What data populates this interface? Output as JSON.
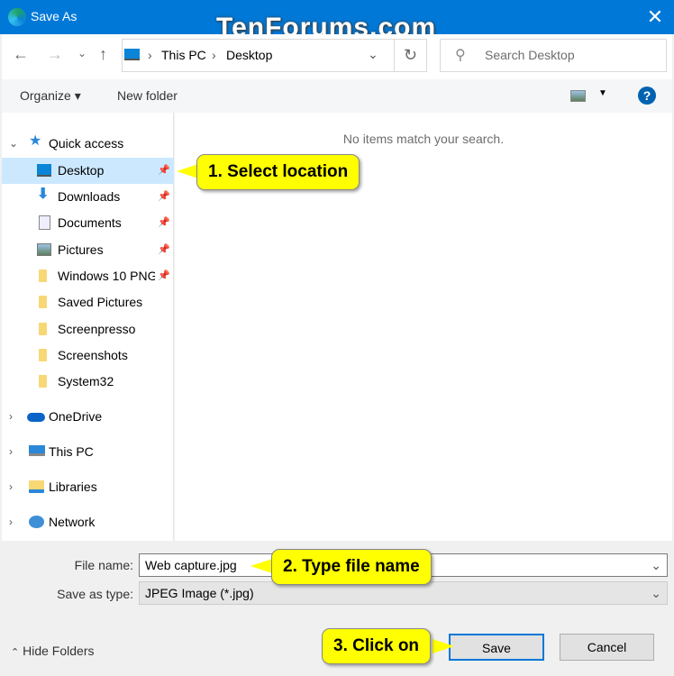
{
  "window": {
    "title": "Save As",
    "watermark": "TenForums.com"
  },
  "nav": {
    "breadcrumb": [
      "This PC",
      "Desktop"
    ],
    "search_placeholder": "Search Desktop"
  },
  "toolbar": {
    "organize": "Organize",
    "new_folder": "New folder"
  },
  "sidebar": {
    "items": [
      {
        "label": "Quick access",
        "icon": "star-icon",
        "level": 0,
        "expanded": true
      },
      {
        "label": "Desktop",
        "icon": "desktop-icon",
        "level": 1,
        "pinned": true,
        "selected": true
      },
      {
        "label": "Downloads",
        "icon": "download-icon",
        "level": 1,
        "pinned": true
      },
      {
        "label": "Documents",
        "icon": "document-icon",
        "level": 1,
        "pinned": true
      },
      {
        "label": "Pictures",
        "icon": "pictures-icon",
        "level": 1,
        "pinned": true
      },
      {
        "label": "Windows 10 PNG",
        "icon": "folder-icon",
        "level": 1,
        "pinned": true
      },
      {
        "label": "Saved Pictures",
        "icon": "folder-icon",
        "level": 1
      },
      {
        "label": "Screenpresso",
        "icon": "folder-icon",
        "level": 1
      },
      {
        "label": "Screenshots",
        "icon": "folder-icon",
        "level": 1
      },
      {
        "label": "System32",
        "icon": "folder-icon",
        "level": 1
      },
      {
        "label": "OneDrive",
        "icon": "cloud-icon",
        "level": 0
      },
      {
        "label": "This PC",
        "icon": "pc-icon",
        "level": 0
      },
      {
        "label": "Libraries",
        "icon": "library-icon",
        "level": 0
      },
      {
        "label": "Network",
        "icon": "network-icon",
        "level": 0
      }
    ]
  },
  "main": {
    "empty_message": "No items match your search."
  },
  "form": {
    "file_name_label": "File name:",
    "file_name_value": "Web capture.jpg",
    "type_label": "Save as type:",
    "type_value": "JPEG Image (*.jpg)"
  },
  "footer": {
    "hide_folders": "Hide Folders",
    "save": "Save",
    "cancel": "Cancel"
  },
  "callouts": {
    "step1": "1. Select location",
    "step2": "2. Type file name",
    "step3": "3. Click on"
  },
  "colors": {
    "titlebar": "#0078d7",
    "selection": "#cce8ff",
    "callout": "#ffff00"
  }
}
